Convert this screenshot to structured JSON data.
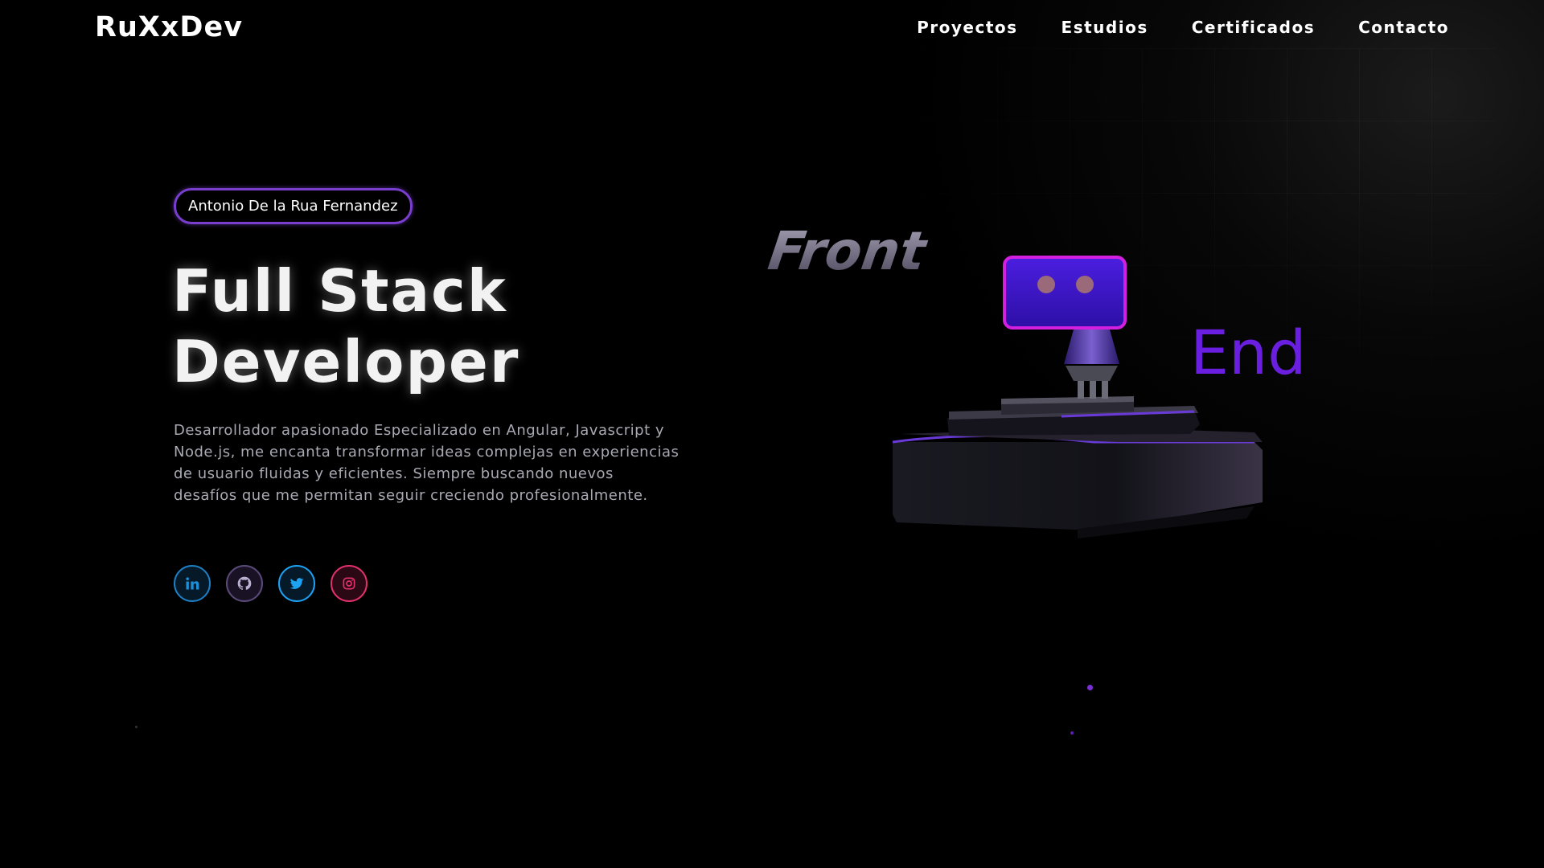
{
  "header": {
    "logo": "RuXxDev",
    "nav": [
      {
        "label": "Proyectos"
      },
      {
        "label": "Estudios"
      },
      {
        "label": "Certificados"
      },
      {
        "label": "Contacto"
      }
    ]
  },
  "hero": {
    "name_badge": "Antonio De la Rua Fernandez",
    "title_line1": "Full Stack",
    "title_line2": "Developer",
    "description": "Desarrollador apasionado Especializado en Angular, Javascript y Node.js, me encanta transformar ideas complejas en experiencias de usuario fluidas y eficientes. Siempre buscando nuevos desafíos que me permitan seguir creciendo profesionalmente."
  },
  "socials": [
    {
      "name": "linkedin",
      "icon": "linkedin-icon"
    },
    {
      "name": "github",
      "icon": "github-icon"
    },
    {
      "name": "twitter",
      "icon": "twitter-icon"
    },
    {
      "name": "instagram",
      "icon": "instagram-icon"
    }
  ],
  "scene": {
    "word_front": "Front",
    "word_end": "End"
  },
  "colors": {
    "background": "#000000",
    "accent_purple": "#7a3ecf",
    "end_text": "#6a1ee0",
    "body_text": "#a9a9b3"
  }
}
